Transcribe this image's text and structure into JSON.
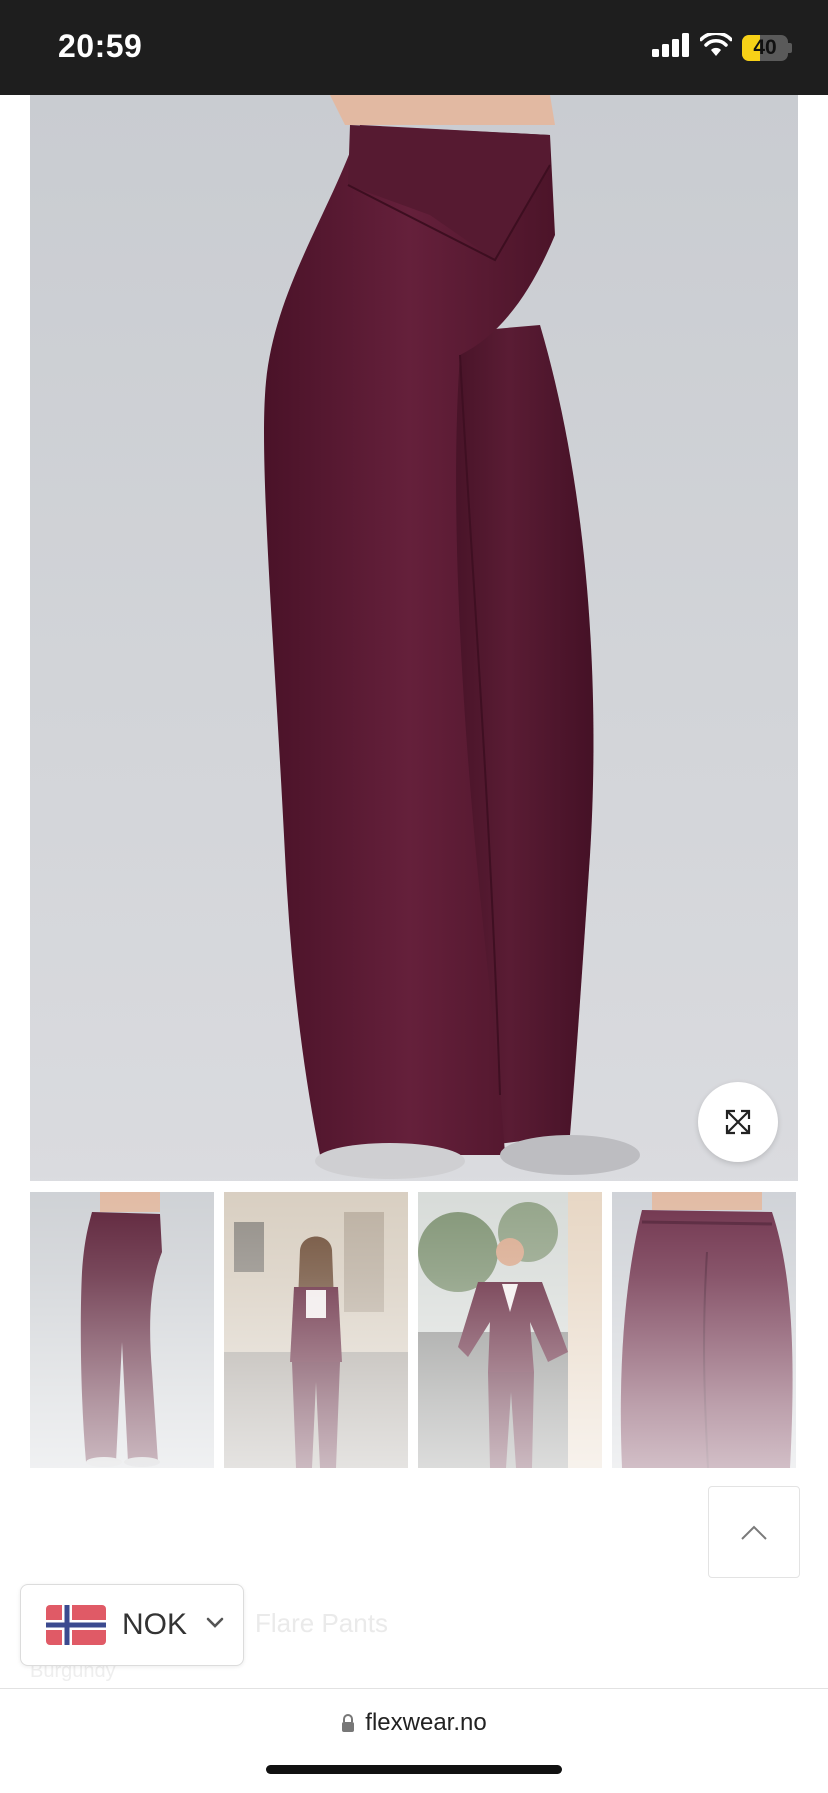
{
  "status_bar": {
    "time": "20:59",
    "battery": "40",
    "battery_level": 0.4
  },
  "product": {
    "gallery_count": 4,
    "ghost_title": "Flare Pants",
    "ghost_subtitle": "Burgundy"
  },
  "currency_selector": {
    "label": "NOK",
    "flag": "norway-flag-icon"
  },
  "browser": {
    "url": "flexwear.no"
  },
  "colors": {
    "garment": "#5b1a32",
    "status_bar": "#1e1e1e",
    "backdrop": "#d3d5d9"
  }
}
